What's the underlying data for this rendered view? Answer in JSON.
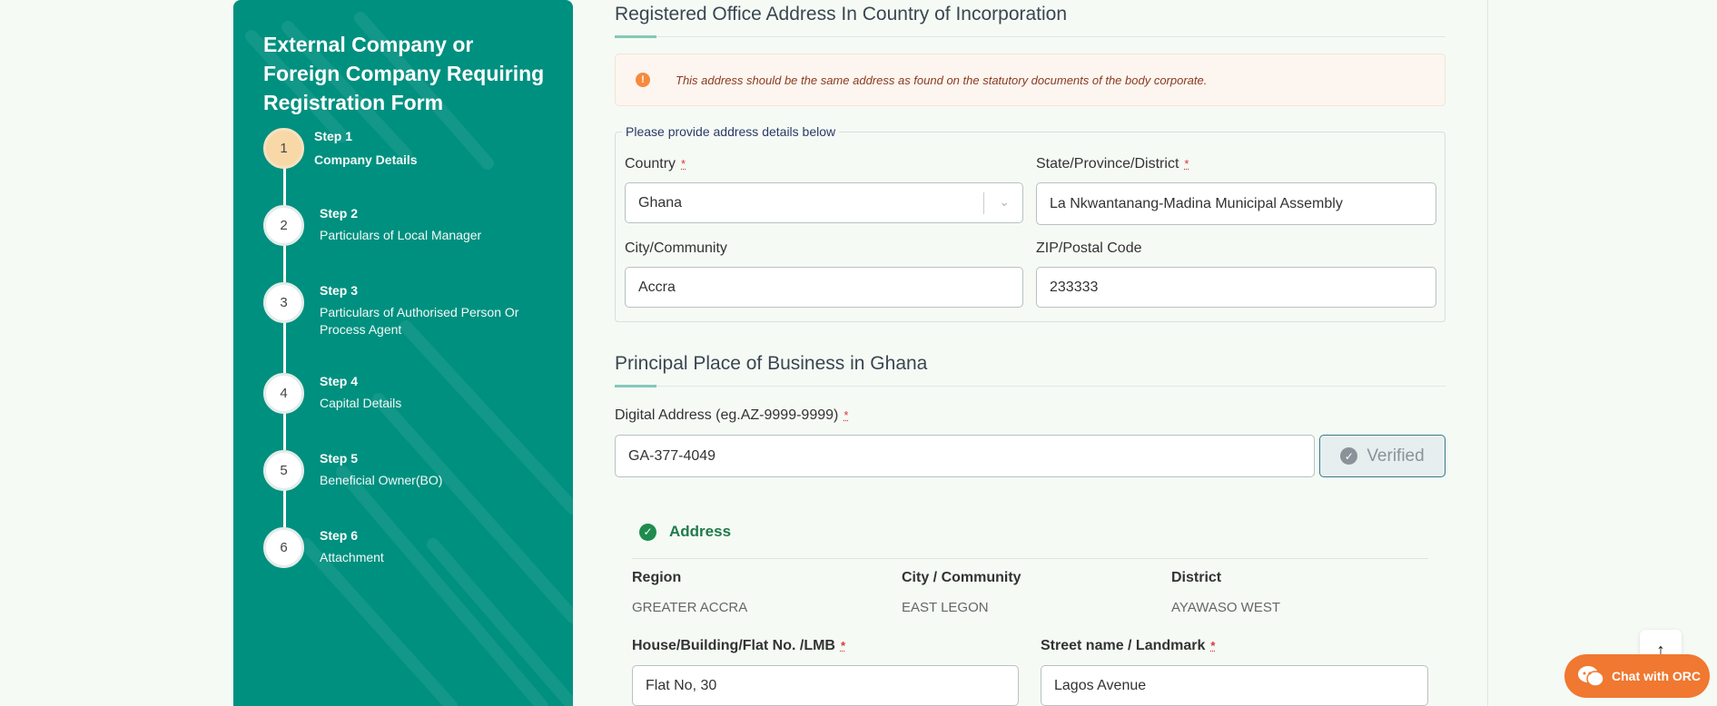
{
  "sidebar": {
    "title": "External Company or Foreign Company Requiring Registration Form",
    "steps": [
      {
        "number": "1",
        "step": "Step 1",
        "name": "Company Details",
        "active": true
      },
      {
        "number": "2",
        "step": "Step 2",
        "name": "Particulars of Local Manager"
      },
      {
        "number": "3",
        "step": "Step 3",
        "name": "Particulars of Authorised Person Or Process Agent"
      },
      {
        "number": "4",
        "step": "Step 4",
        "name": "Capital Details"
      },
      {
        "number": "5",
        "step": "Step 5",
        "name": "Beneficial Owner(BO)"
      },
      {
        "number": "6",
        "step": "Step 6",
        "name": "Attachment"
      }
    ]
  },
  "registered_office": {
    "title": "Registered Office Address In Country of Incorporation",
    "alert": "This address should be the same address as found on the statutory documents of the body corporate.",
    "legend": "Please provide address details below",
    "country_label": "Country",
    "country_value": "Ghana",
    "state_label": "State/Province/District",
    "state_value": "La Nkwantanang-Madina Municipal Assembly",
    "city_label": "City/Community",
    "city_value": "Accra",
    "zip_label": "ZIP/Postal Code",
    "zip_value": "233333",
    "required_mark": "*"
  },
  "principal_place": {
    "title": "Principal Place of Business in Ghana",
    "digital_label": "Digital Address (eg.AZ-9999-9999)",
    "digital_value": "GA-377-4049",
    "verify_label": "Verified",
    "address_heading": "Address",
    "region_label": "Region",
    "region_value": "GREATER ACCRA",
    "city_label": "City / Community",
    "city_value": "EAST LEGON",
    "district_label": "District",
    "district_value": "AYAWASO WEST",
    "house_label": "House/Building/Flat No. /LMB",
    "house_value": "Flat No, 30",
    "street_label": "Street name / Landmark",
    "street_value": "Lagos Avenue"
  },
  "chat": {
    "label": "Chat with ORC"
  },
  "colors": {
    "sidebar": "#00907f",
    "accent": "#f07830",
    "active_step": "#f9d8a8"
  }
}
